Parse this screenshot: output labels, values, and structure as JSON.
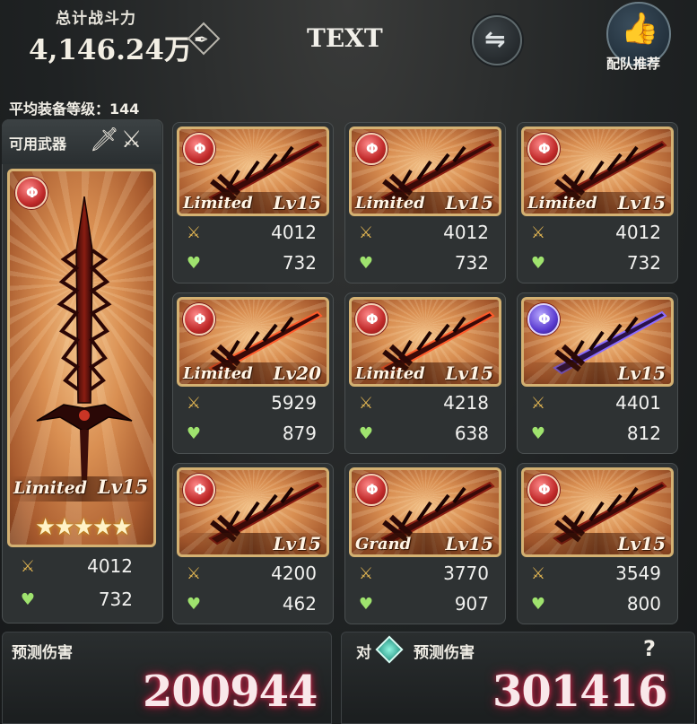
{
  "header": {
    "total_power_label": "总计战斗力",
    "total_power_value": "4,146.24万",
    "title": "TEXT",
    "recommend_label": "配队推荐",
    "avg_equip_level": "平均装备等级：144"
  },
  "left": {
    "available_weapons_label": "可用武器",
    "main_weapon": {
      "tag": "Limited",
      "level": "Lv15",
      "stars": "★★★★★",
      "atk": "4012",
      "hp": "732",
      "element": "fire"
    }
  },
  "grid": [
    {
      "tag": "Limited",
      "level": "Lv15",
      "atk": "4012",
      "hp": "732",
      "element": "fire"
    },
    {
      "tag": "Limited",
      "level": "Lv15",
      "atk": "4012",
      "hp": "732",
      "element": "fire"
    },
    {
      "tag": "Limited",
      "level": "Lv15",
      "atk": "4012",
      "hp": "732",
      "element": "fire"
    },
    {
      "tag": "Limited",
      "level": "Lv20",
      "atk": "5929",
      "hp": "879",
      "element": "fire"
    },
    {
      "tag": "Limited",
      "level": "Lv15",
      "atk": "4218",
      "hp": "638",
      "element": "fire"
    },
    {
      "tag": "",
      "level": "Lv15",
      "atk": "4401",
      "hp": "812",
      "element": "dark"
    },
    {
      "tag": "",
      "level": "Lv15",
      "atk": "4200",
      "hp": "462",
      "element": "fire"
    },
    {
      "tag": "Grand",
      "level": "Lv15",
      "atk": "3770",
      "hp": "907",
      "element": "fire"
    },
    {
      "tag": "",
      "level": "Lv15",
      "atk": "3549",
      "hp": "800",
      "element": "fire"
    }
  ],
  "damage": {
    "left_label": "预测伤害",
    "left_value": "200944",
    "right_prefix": "对",
    "right_label": "预测伤害",
    "right_value": "301416",
    "help": "?"
  },
  "colors": {
    "accent_gold": "#d4b172",
    "fire": "#c02a2a",
    "dark": "#5a3bd0",
    "hp_green": "#9fe36e",
    "atk_gold": "#e1b552",
    "damage_glow": "#d03050"
  },
  "icons": {
    "edit": "quill-icon",
    "swap": "swap-icon",
    "recommend": "thumbs-up-icon",
    "attack": "crossed-swords-icon",
    "hp": "heart-icon",
    "wind": "wind-element-icon"
  }
}
